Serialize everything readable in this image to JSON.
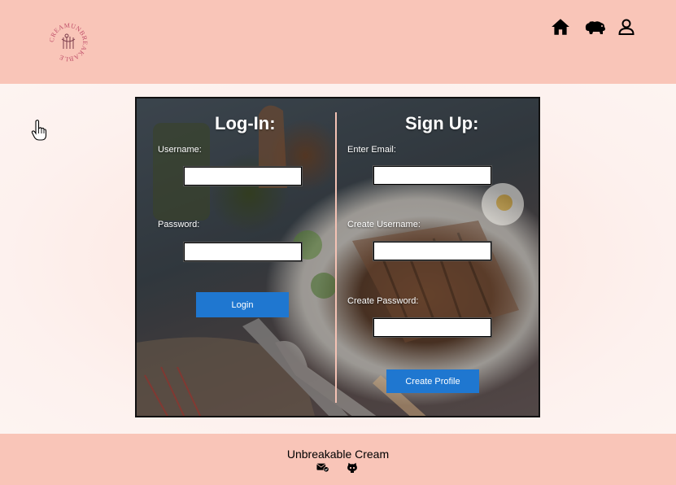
{
  "header": {
    "logo_text": "CREAMUNBREAKABLE",
    "nav": [
      {
        "icon": "home-icon"
      },
      {
        "icon": "hippo-icon"
      },
      {
        "icon": "user-icon"
      }
    ]
  },
  "login": {
    "title": "Log-In:",
    "username_label": "Username:",
    "username_value": "",
    "password_label": "Password:",
    "password_value": "",
    "button_label": "Login"
  },
  "signup": {
    "title": "Sign Up:",
    "email_label": "Enter Email:",
    "email_value": "",
    "username_label": "Create Username:",
    "username_value": "",
    "password_label": "Create Password:",
    "password_value": "",
    "button_label": "Create Profile"
  },
  "footer": {
    "title": "Unbreakable Cream",
    "icons": [
      "mail-check-icon",
      "github-icon"
    ]
  },
  "colors": {
    "header_bg": "#f9c5b8",
    "button_bg": "#1f77d0",
    "divider": "#f4c2b4"
  }
}
